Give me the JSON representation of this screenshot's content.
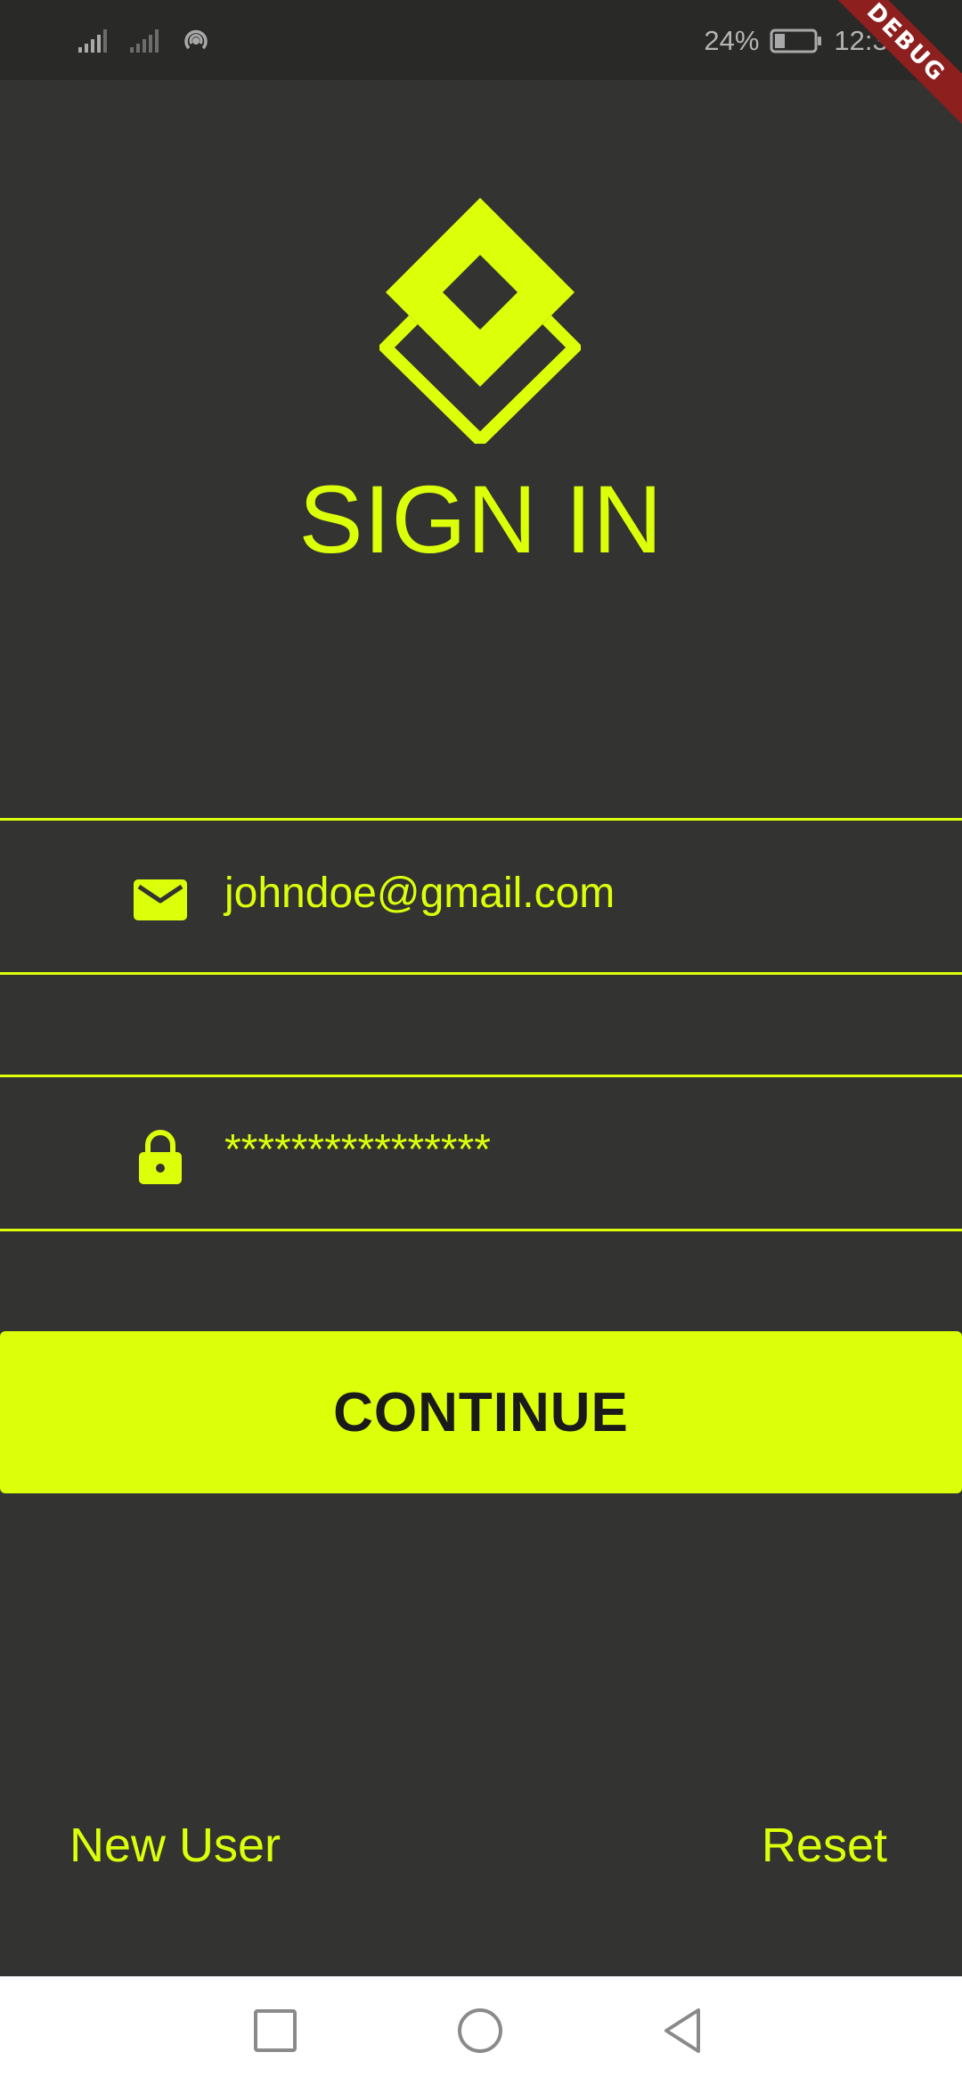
{
  "status_bar": {
    "battery_percent": "24%",
    "time": "12:34",
    "debug_label": "DEBUG"
  },
  "title": "SIGN IN",
  "email_field": {
    "value": "johndoe@gmail.com",
    "icon": "mail-icon"
  },
  "password_field": {
    "value": "****************",
    "icon": "lock-icon"
  },
  "continue_label": "CONTINUE",
  "links": {
    "new_user": "New User",
    "reset": "Reset"
  },
  "colors": {
    "accent": "#dcff0a",
    "background": "#333331",
    "status_bar": "#292927",
    "nav_bar": "#ffffff"
  },
  "nav_icons": [
    "recent-apps-icon",
    "home-icon",
    "back-icon"
  ]
}
